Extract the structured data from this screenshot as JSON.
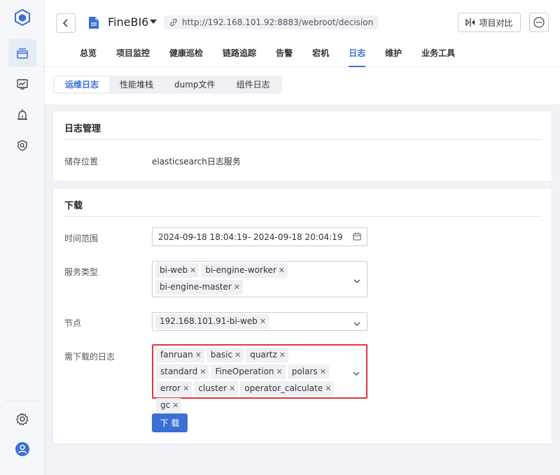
{
  "app": {
    "project_title": "FineBI6",
    "url": "http://192.168.101.92:8883/webroot/decision",
    "compare_label": "项目对比"
  },
  "nav_rail": {
    "items": [
      "layers-icon",
      "monitor-chart-icon",
      "alarm-icon",
      "shield-search-icon"
    ],
    "bottom": [
      "settings-icon",
      "user-avatar-icon"
    ]
  },
  "tabs": [
    {
      "label": "总览"
    },
    {
      "label": "项目监控"
    },
    {
      "label": "健康巡检"
    },
    {
      "label": "链路追踪"
    },
    {
      "label": "告警"
    },
    {
      "label": "宕机"
    },
    {
      "label": "日志",
      "active": true
    },
    {
      "label": "维护"
    },
    {
      "label": "业务工具"
    }
  ],
  "subtabs": [
    {
      "label": "运维日志",
      "active": true
    },
    {
      "label": "性能堆栈"
    },
    {
      "label": "dump文件"
    },
    {
      "label": "组件日志"
    }
  ],
  "log_mgmt": {
    "title": "日志管理",
    "storage_label": "储存位置",
    "storage_value": "elasticsearch日志服务"
  },
  "download": {
    "title": "下载",
    "time_label": "时间范围",
    "time_start": "2024-09-18 18:04:19",
    "time_sep": "-",
    "time_end": "2024-09-18 20:04:19",
    "service_label": "服务类型",
    "services": [
      "bi-web",
      "bi-engine-worker",
      "bi-engine-master"
    ],
    "node_label": "节点",
    "nodes": [
      "192.168.101.91-bi-web"
    ],
    "logs_label": "需下载的日志",
    "logs": [
      "fanruan",
      "basic",
      "quartz",
      "standard",
      "FineOperation",
      "polars",
      "error",
      "cluster",
      "operator_calculate",
      "gc"
    ],
    "button_label": "下 载"
  },
  "colors": {
    "accent": "#3b6fd6",
    "error_border": "#e0353b"
  }
}
